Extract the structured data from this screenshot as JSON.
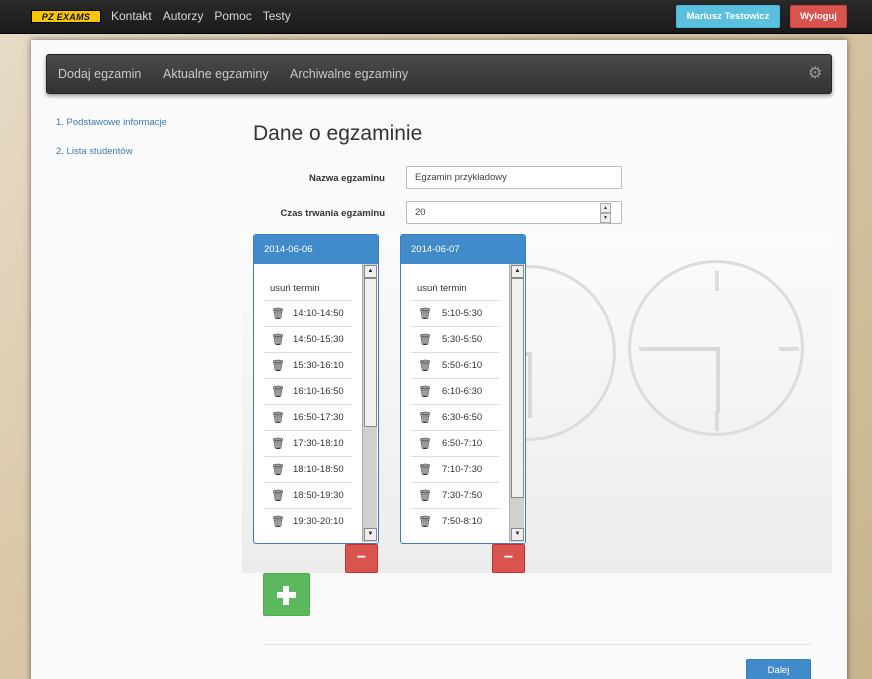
{
  "topbar": {
    "logo": "PZ EXAMS",
    "nav": [
      "Kontakt",
      "Autorzy",
      "Pomoc",
      "Testy"
    ],
    "user_button": "Mariusz Testowicz",
    "logout_button": "Wyloguj"
  },
  "subnav": {
    "items": [
      "Dodaj egzamin",
      "Aktualne egzaminy",
      "Archiwalne egzaminy"
    ],
    "settings_icon": "gear-icon"
  },
  "sidebar": {
    "steps": [
      "1. Podstawowe informacje",
      "2. Lista studentów"
    ]
  },
  "main": {
    "title": "Dane o egzaminie",
    "exam_name_label": "Nazwa egzaminu",
    "exam_name_value": "Egzamin przykładowy",
    "duration_label": "Czas trwania egzaminu",
    "duration_value": "20"
  },
  "days": [
    {
      "date": "2014-06-06",
      "remove_label": "usuń termin",
      "slots": [
        "14:10-14:50",
        "14:50-15:30",
        "15:30-16:10",
        "16:10-16:50",
        "16:50-17:30",
        "17:30-18:10",
        "18:10-18:50",
        "18:50-19:30",
        "19:30-20:10"
      ],
      "scroll_fraction": 0.55
    },
    {
      "date": "2014-06-07",
      "remove_label": "usuń termin",
      "slots": [
        "5:10-5:30",
        "5:30-5:50",
        "5:50-6:10",
        "6:10-6:30",
        "6:30-6:50",
        "6:50-7:10",
        "7:10-7:30",
        "7:30-7:50",
        "7:50-8:10"
      ],
      "scroll_fraction": 0.9
    }
  ],
  "buttons": {
    "remove_day": "−",
    "add_day": "+",
    "next": "Dalej"
  },
  "colors": {
    "primary": "#428bca",
    "danger": "#d9534f",
    "success": "#5cb85c",
    "info": "#5bc0de"
  }
}
